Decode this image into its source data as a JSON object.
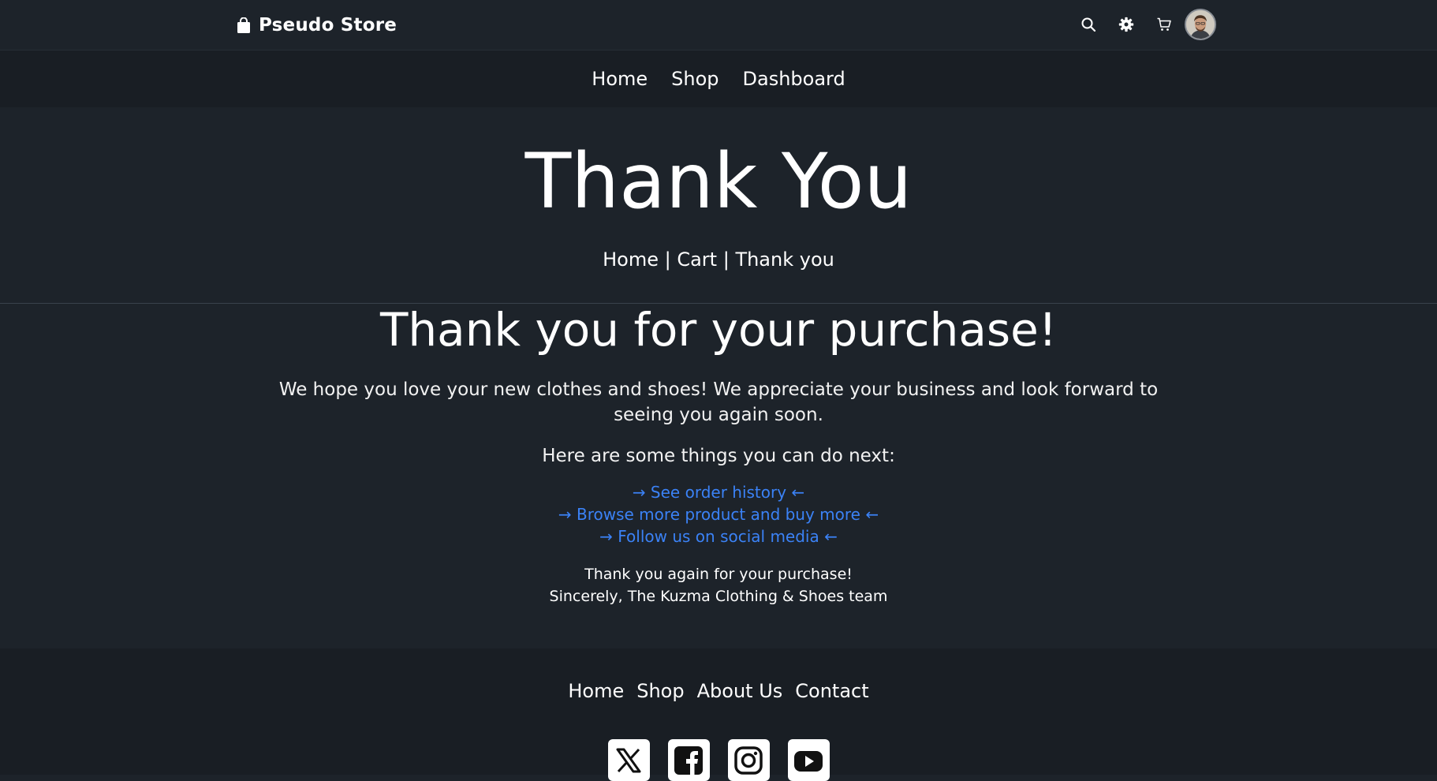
{
  "header": {
    "brand": "Pseudo Store",
    "icons": [
      "search-icon",
      "gear-icon",
      "cart-icon",
      "avatar"
    ]
  },
  "nav": {
    "items": [
      "Home",
      "Shop",
      "Dashboard"
    ]
  },
  "hero": {
    "title": "Thank You",
    "breadcrumb": {
      "home": "Home",
      "sep1": " | ",
      "cart": "Cart",
      "sep2": " | ",
      "current": "Thank you"
    }
  },
  "main": {
    "heading": "Thank you for your purchase!",
    "lead": "We hope you love your new clothes and shoes! We appreciate your business and look forward to seeing you again soon.",
    "next_intro": "Here are some things you can do next:",
    "links": [
      "→ See order history ←",
      "→ Browse more product and buy more ←",
      "→ Follow us on social media ←"
    ],
    "signoff_line1": "Thank you again for your purchase!",
    "signoff_line2": "Sincerely, The Kuzma Clothing & Shoes team"
  },
  "footer": {
    "links": [
      "Home",
      "Shop",
      "About Us",
      "Contact"
    ],
    "socials": [
      "x-icon",
      "facebook-icon",
      "instagram-icon",
      "youtube-icon"
    ]
  },
  "colors": {
    "page_bg": "#1d232a",
    "band_bg": "#191e24",
    "link": "#3b82f6",
    "text": "#ffffff"
  }
}
